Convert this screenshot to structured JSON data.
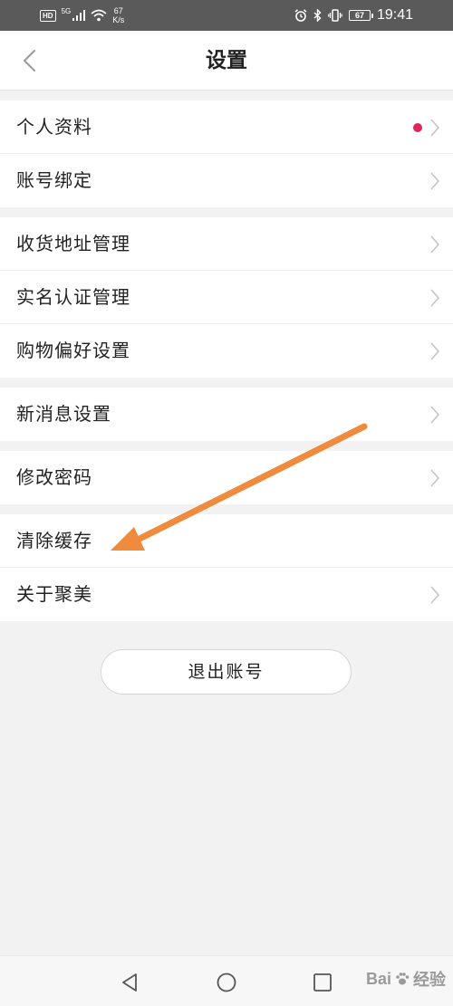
{
  "status_bar": {
    "hd": "HD",
    "network": "5G",
    "speed_value": "67",
    "speed_unit": "K/s",
    "battery": "67",
    "time": "19:41"
  },
  "header": {
    "title": "设置"
  },
  "groups": [
    {
      "items": [
        {
          "label": "个人资料",
          "has_dot": true
        },
        {
          "label": "账号绑定"
        }
      ]
    },
    {
      "items": [
        {
          "label": "收货地址管理"
        },
        {
          "label": "实名认证管理"
        },
        {
          "label": "购物偏好设置"
        }
      ]
    },
    {
      "items": [
        {
          "label": "新消息设置"
        }
      ]
    },
    {
      "items": [
        {
          "label": "修改密码"
        }
      ]
    },
    {
      "items": [
        {
          "label": "清除缓存",
          "has_chevron": false
        },
        {
          "label": "关于聚美"
        }
      ]
    }
  ],
  "logout_label": "退出账号",
  "colors": {
    "dot": "#e0245e",
    "arrow": "#f08a3c",
    "status_bar": "#5a5a5a"
  },
  "icons": {
    "back": "chevron-left-icon",
    "row": "chevron-right-icon",
    "nav_back": "triangle-back-icon",
    "nav_home": "circle-home-icon",
    "nav_recent": "square-recent-icon"
  },
  "watermark": {
    "text": "Bai",
    "suffix": "经验"
  }
}
